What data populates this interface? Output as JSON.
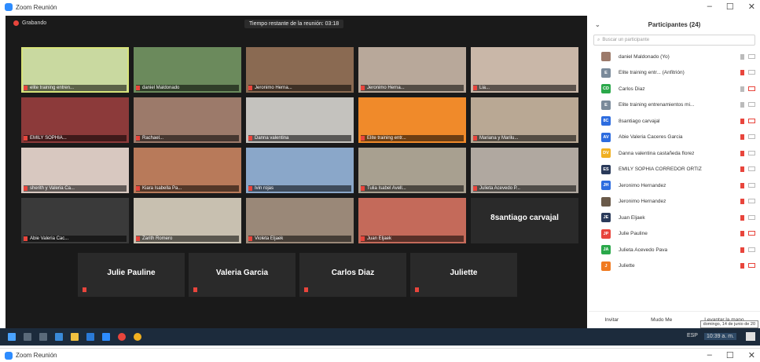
{
  "window": {
    "title": "Zoom Reunión",
    "min": "–",
    "max": "☐",
    "close": "✕"
  },
  "meeting": {
    "recording": "Grabando",
    "timer": "Tiempo restante de la reunión: 03:18",
    "video_tiles": [
      {
        "name": "elite training entren...",
        "bg": "#c9d9a0",
        "active": true
      },
      {
        "name": "daniel Maldonado",
        "bg": "#6b8a5c"
      },
      {
        "name": "Jeronimo Herna...",
        "bg": "#8a6a52"
      },
      {
        "name": "Jeronimo Herna...",
        "bg": "#b8a89a"
      },
      {
        "name": "Lia...",
        "bg": "#c9b7a8"
      },
      {
        "name": "EMILY SOPHIA...",
        "bg": "#8c3a3a"
      },
      {
        "name": "Rachael...",
        "bg": "#9c7a6a"
      },
      {
        "name": "Danna valentina",
        "bg": "#c4c2be"
      },
      {
        "name": "Elite training entr...",
        "bg": "#f08a2a"
      },
      {
        "name": "Mariana y Marilu...",
        "bg": "#b9a894"
      },
      {
        "name": "sherith y Valeria Ca...",
        "bg": "#d8c8c0"
      },
      {
        "name": "Kiara Isabella Pa...",
        "bg": "#b87a5a"
      },
      {
        "name": "Ivin rojas",
        "bg": "#8aa7c9"
      },
      {
        "name": "Tulia Isabel Avell...",
        "bg": "#a8a090"
      },
      {
        "name": "Julieta Acevedo P...",
        "bg": "#b0a8a0"
      },
      {
        "name": "Abie Valeria Cac...",
        "bg": "#3a3a3a"
      },
      {
        "name": "Zarith Romero",
        "bg": "#c8c0b0"
      },
      {
        "name": "Violeta Eljaek",
        "bg": "#9a8878"
      },
      {
        "name": "Juan Eljaek",
        "bg": "#c46a5a"
      }
    ],
    "name_tiles": [
      {
        "name": "8santiago carvajal"
      },
      {
        "name": "Julie Pauline"
      },
      {
        "name": "Valeria Garcia"
      },
      {
        "name": "Carlos Diaz"
      },
      {
        "name": "Juliette"
      }
    ]
  },
  "participants": {
    "title": "Participantes (24)",
    "search_placeholder": "Buscar un participante",
    "list": [
      {
        "initials": "",
        "name": "daniel Maldonado (Yo)",
        "color": "#9c7a6a",
        "mic": "on",
        "cam": "on"
      },
      {
        "initials": "E",
        "name": "Elite training entr... (Anfitrión)",
        "color": "#7a8a9a",
        "mic": "off",
        "cam": "on"
      },
      {
        "initials": "CD",
        "name": "Carlos Diaz",
        "color": "#2aa84a",
        "mic": "on",
        "cam": "off"
      },
      {
        "initials": "E",
        "name": "Elite training entrenamientos mi...",
        "color": "#7a8a9a",
        "mic": "on",
        "cam": "on"
      },
      {
        "initials": "8C",
        "name": "8santiago carvajal",
        "color": "#2d6cdf",
        "mic": "off",
        "cam": "off"
      },
      {
        "initials": "AV",
        "name": "Abie Valeria Caceres Garcia",
        "color": "#2d6cdf",
        "mic": "off",
        "cam": "on"
      },
      {
        "initials": "DV",
        "name": "Danna valentina castañeda florez",
        "color": "#f0b020",
        "mic": "off",
        "cam": "on"
      },
      {
        "initials": "ES",
        "name": "EMILY SOPHIA CORREDOR ORTIZ",
        "color": "#2a3a5a",
        "mic": "off",
        "cam": "on"
      },
      {
        "initials": "JH",
        "name": "Jeronimo Hernandez",
        "color": "#2d6cdf",
        "mic": "off",
        "cam": "on"
      },
      {
        "initials": "",
        "name": "Jeronimo Hernandez",
        "color": "#6a5a4a",
        "mic": "off",
        "cam": "on"
      },
      {
        "initials": "JE",
        "name": "Juan Eljaek",
        "color": "#2a3a5a",
        "mic": "off",
        "cam": "on"
      },
      {
        "initials": "JP",
        "name": "Julie Pauline",
        "color": "#e8453c",
        "mic": "off",
        "cam": "off"
      },
      {
        "initials": "JA",
        "name": "Julieta Acevedo Pava",
        "color": "#2aa84a",
        "mic": "off",
        "cam": "on"
      },
      {
        "initials": "J",
        "name": "Juliette",
        "color": "#f07a20",
        "mic": "off",
        "cam": "off"
      }
    ],
    "footer": {
      "invite": "Invitar",
      "mute_all": "Mudo Me",
      "lower_hand": "Levantar la mano"
    },
    "date_tip": "domingo, 14 de junio de 20"
  },
  "taskbar": {
    "tray_lang": "ESP",
    "tray_time": "10:39 a. m."
  }
}
